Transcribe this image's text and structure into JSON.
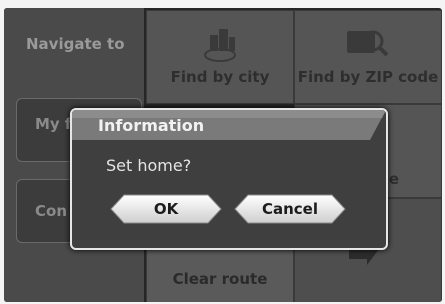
{
  "sidebar": {
    "navigate_label": "Navigate to",
    "favorites_label": "My fav",
    "contacts_label": "Con"
  },
  "tiles": {
    "find_by_city": "Find by city",
    "find_by_zip": "Find by ZIP code",
    "middle_fragment": "e",
    "clear_route": "Clear route"
  },
  "dialog": {
    "title": "Information",
    "message": "Set home?",
    "ok_label": "OK",
    "cancel_label": "Cancel"
  },
  "icons": {
    "city": "city-search-icon",
    "zip": "zip-search-icon",
    "arrow": "arrow-icon"
  }
}
